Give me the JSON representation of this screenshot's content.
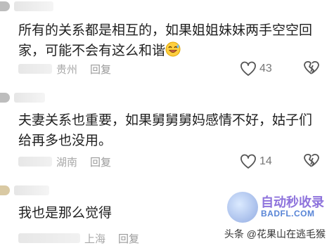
{
  "comments": [
    {
      "text": "所有的关系都是相互的，如果姐姐妹妹两手空空回家，可能不会有这么和谐",
      "emoji": "laughing-sweat-emoji",
      "location": "贵州",
      "reply_label": "回复",
      "likes": "43"
    },
    {
      "text": "夫妻关系也重要，如果舅舅舅妈感情不好，姑子们给再多也没用。",
      "location": "湖南",
      "reply_label": "回复",
      "likes": "14"
    },
    {
      "text": "我也是那么觉得",
      "location": "上海",
      "reply_label": "回复",
      "likes": ""
    }
  ],
  "watermark": {
    "title": "自动秒收录",
    "url": "BADFL.COM"
  },
  "source": "头条 @花果山在逃毛猴",
  "icons": {
    "like": "heart-icon",
    "dislike": "broken-heart-icon"
  }
}
